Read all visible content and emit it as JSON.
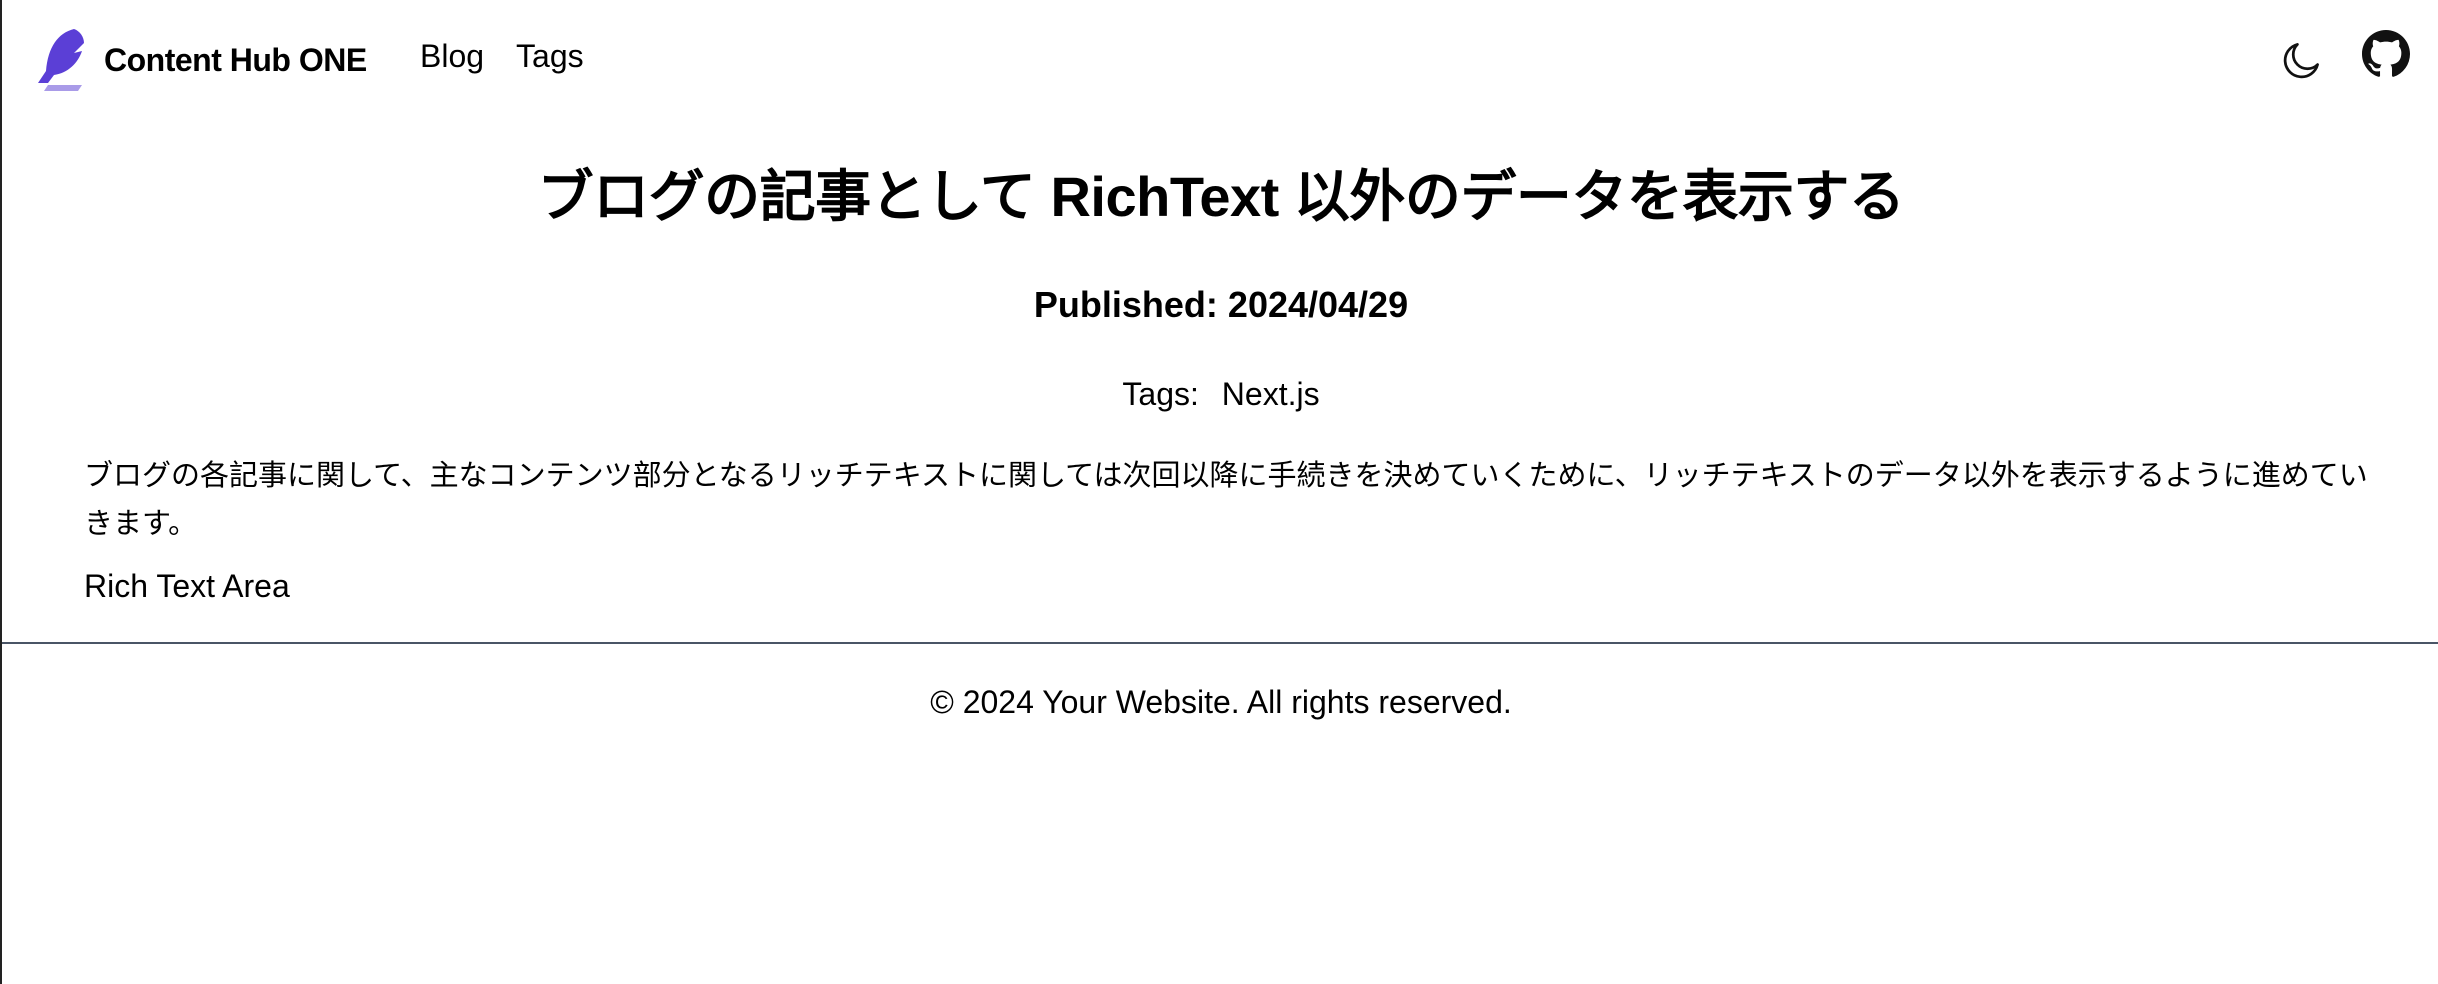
{
  "header": {
    "brand_name": "Content Hub ONE",
    "nav": [
      {
        "label": "Blog"
      },
      {
        "label": "Tags"
      }
    ],
    "icons": {
      "logo": "feather-logo-icon",
      "theme_toggle": "moon-icon",
      "github": "github-icon"
    },
    "colors": {
      "logo_primary": "#5b3fd6",
      "logo_secondary": "#a99be8"
    }
  },
  "article": {
    "title": "ブログの記事として RichText 以外のデータを表示する",
    "published": "Published: 2024/04/29",
    "tags_label": "Tags:",
    "tags": [
      "Next.js"
    ],
    "body": "ブログの各記事に関して、主なコンテンツ部分となるリッチテキストに関しては次回以降に手続きを決めていくために、リッチテキストのデータ以外を表示するように進めていきます。",
    "rich_text_placeholder": "Rich Text Area"
  },
  "footer": {
    "copyright": "© 2024 Your Website. All rights reserved."
  }
}
